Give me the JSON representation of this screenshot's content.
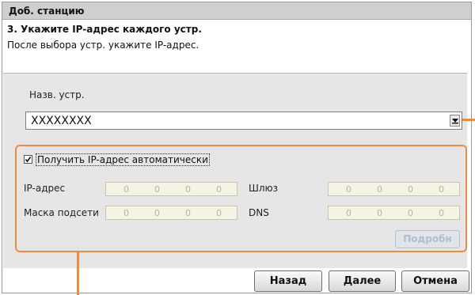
{
  "window": {
    "title": "Доб. станцию"
  },
  "step": {
    "title": "3. Укажите IP-адрес каждого устр.",
    "description": "После выбора устр. укажите IP-адрес."
  },
  "device": {
    "label": "Назв. устр.",
    "value": "XXXXXXXX"
  },
  "auto_ip": {
    "label": "Получить IP-адрес автоматически",
    "checked": true
  },
  "fields": {
    "ip_label": "IP-адрес",
    "gateway_label": "Шлюз",
    "mask_label": "Маска подсети",
    "dns_label": "DNS",
    "octets": [
      "0",
      "0",
      "0",
      "0"
    ]
  },
  "buttons": {
    "apply": "Подробн",
    "back": "Назад",
    "next": "Далее",
    "cancel": "Отмена"
  },
  "colors": {
    "highlight": "#f08a3e"
  }
}
